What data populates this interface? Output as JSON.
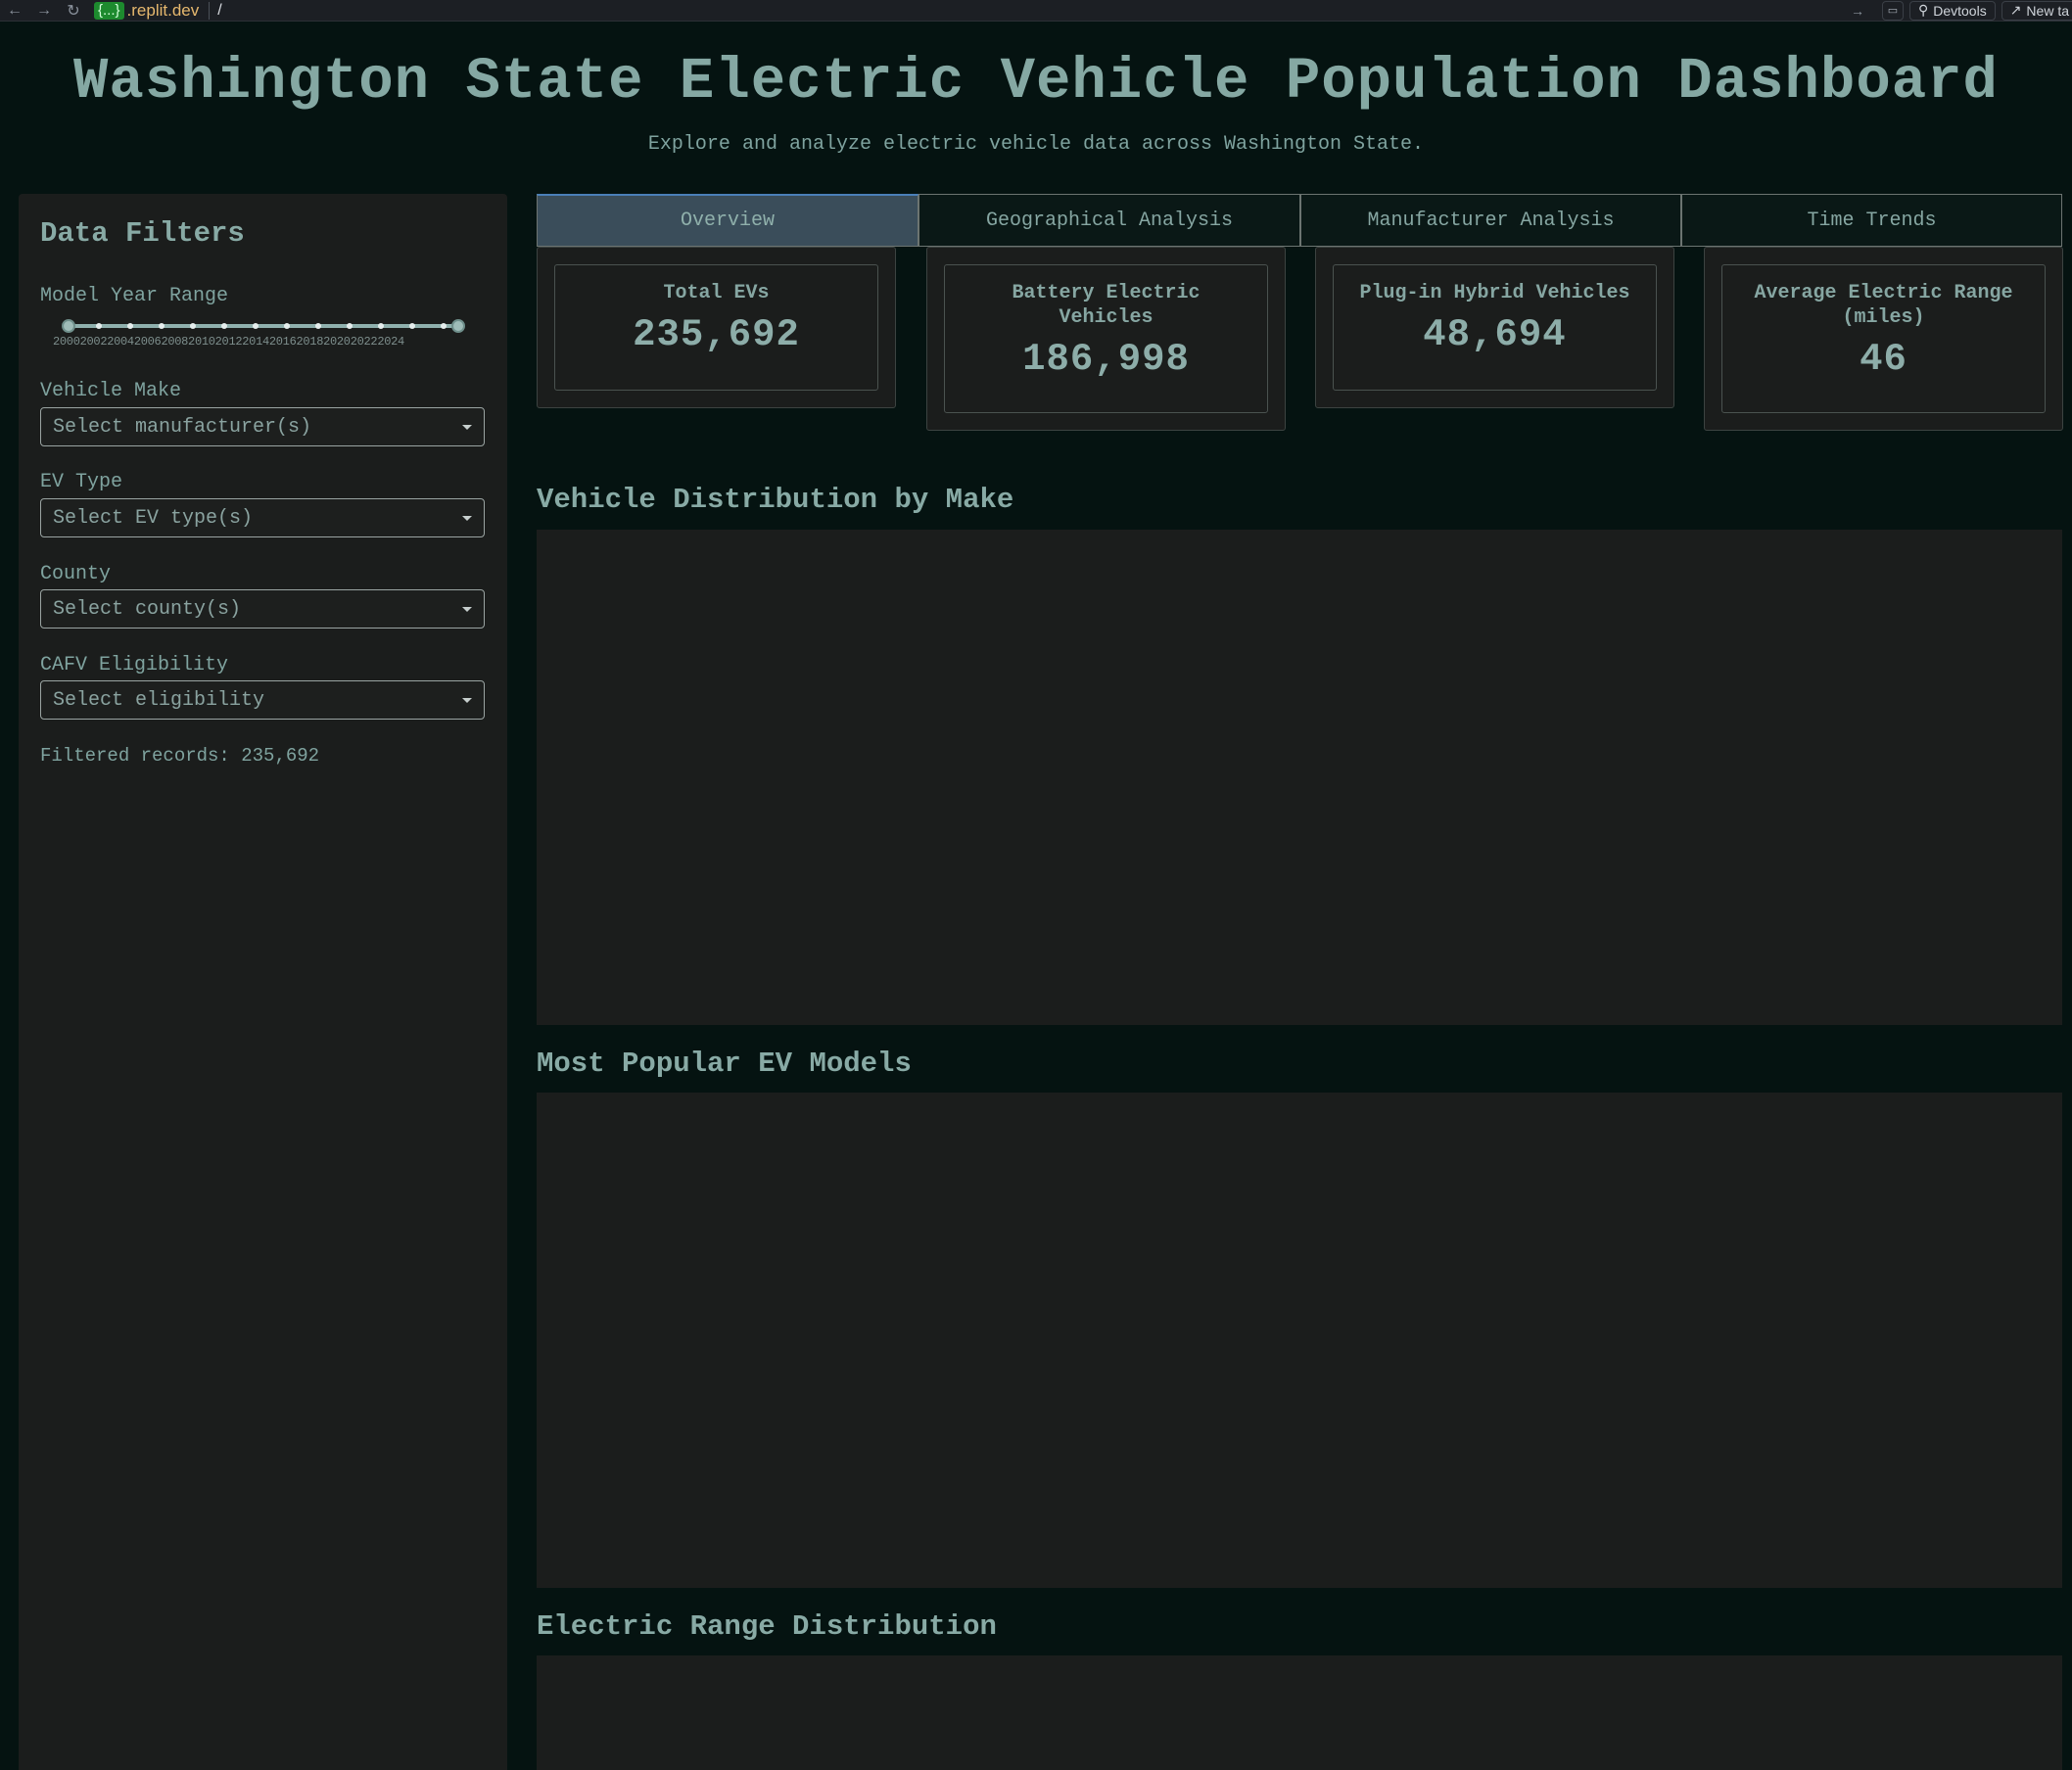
{
  "browser": {
    "url_badge": "{...}",
    "url_domain": ".replit.dev",
    "url_path": "/",
    "devtools_label": "Devtools",
    "newtab_label": "New ta"
  },
  "header": {
    "title": "Washington State Electric Vehicle Population Dashboard",
    "subtitle": "Explore and analyze electric vehicle data across Washington State."
  },
  "sidebar": {
    "title": "Data Filters",
    "year_range_label": "Model Year Range",
    "year_ticks": [
      "2000",
      "2002",
      "2004",
      "2006",
      "2008",
      "2010",
      "2012",
      "2014",
      "2016",
      "2018",
      "2020",
      "2022",
      "2024"
    ],
    "year_range_selected": [
      2000,
      2024
    ],
    "make_label": "Vehicle Make",
    "make_placeholder": "Select manufacturer(s)",
    "evtype_label": "EV Type",
    "evtype_placeholder": "Select EV type(s)",
    "county_label": "County",
    "county_placeholder": "Select county(s)",
    "cafv_label": "CAFV Eligibility",
    "cafv_placeholder": "Select eligibility",
    "filtered_records": "Filtered records: 235,692"
  },
  "tabs": [
    {
      "label": "Overview",
      "active": true
    },
    {
      "label": "Geographical Analysis",
      "active": false
    },
    {
      "label": "Manufacturer Analysis",
      "active": false
    },
    {
      "label": "Time Trends",
      "active": false
    }
  ],
  "stats": [
    {
      "label": "Total EVs",
      "value": "235,692"
    },
    {
      "label": "Battery Electric Vehicles",
      "value": "186,998"
    },
    {
      "label": "Plug-in Hybrid Vehicles",
      "value": "48,694"
    },
    {
      "label": "Average Electric Range (miles)",
      "value": "46"
    }
  ],
  "sections": {
    "make_distribution": "Vehicle Distribution by Make",
    "popular_models": "Most Popular EV Models",
    "range_distribution": "Electric Range Distribution"
  },
  "colors": {
    "background": "#051311",
    "panel": "#1b1d1c",
    "text": "#7fa39f",
    "active_tab": "#3a4d5a",
    "active_tab_accent": "#4a7fb8"
  }
}
